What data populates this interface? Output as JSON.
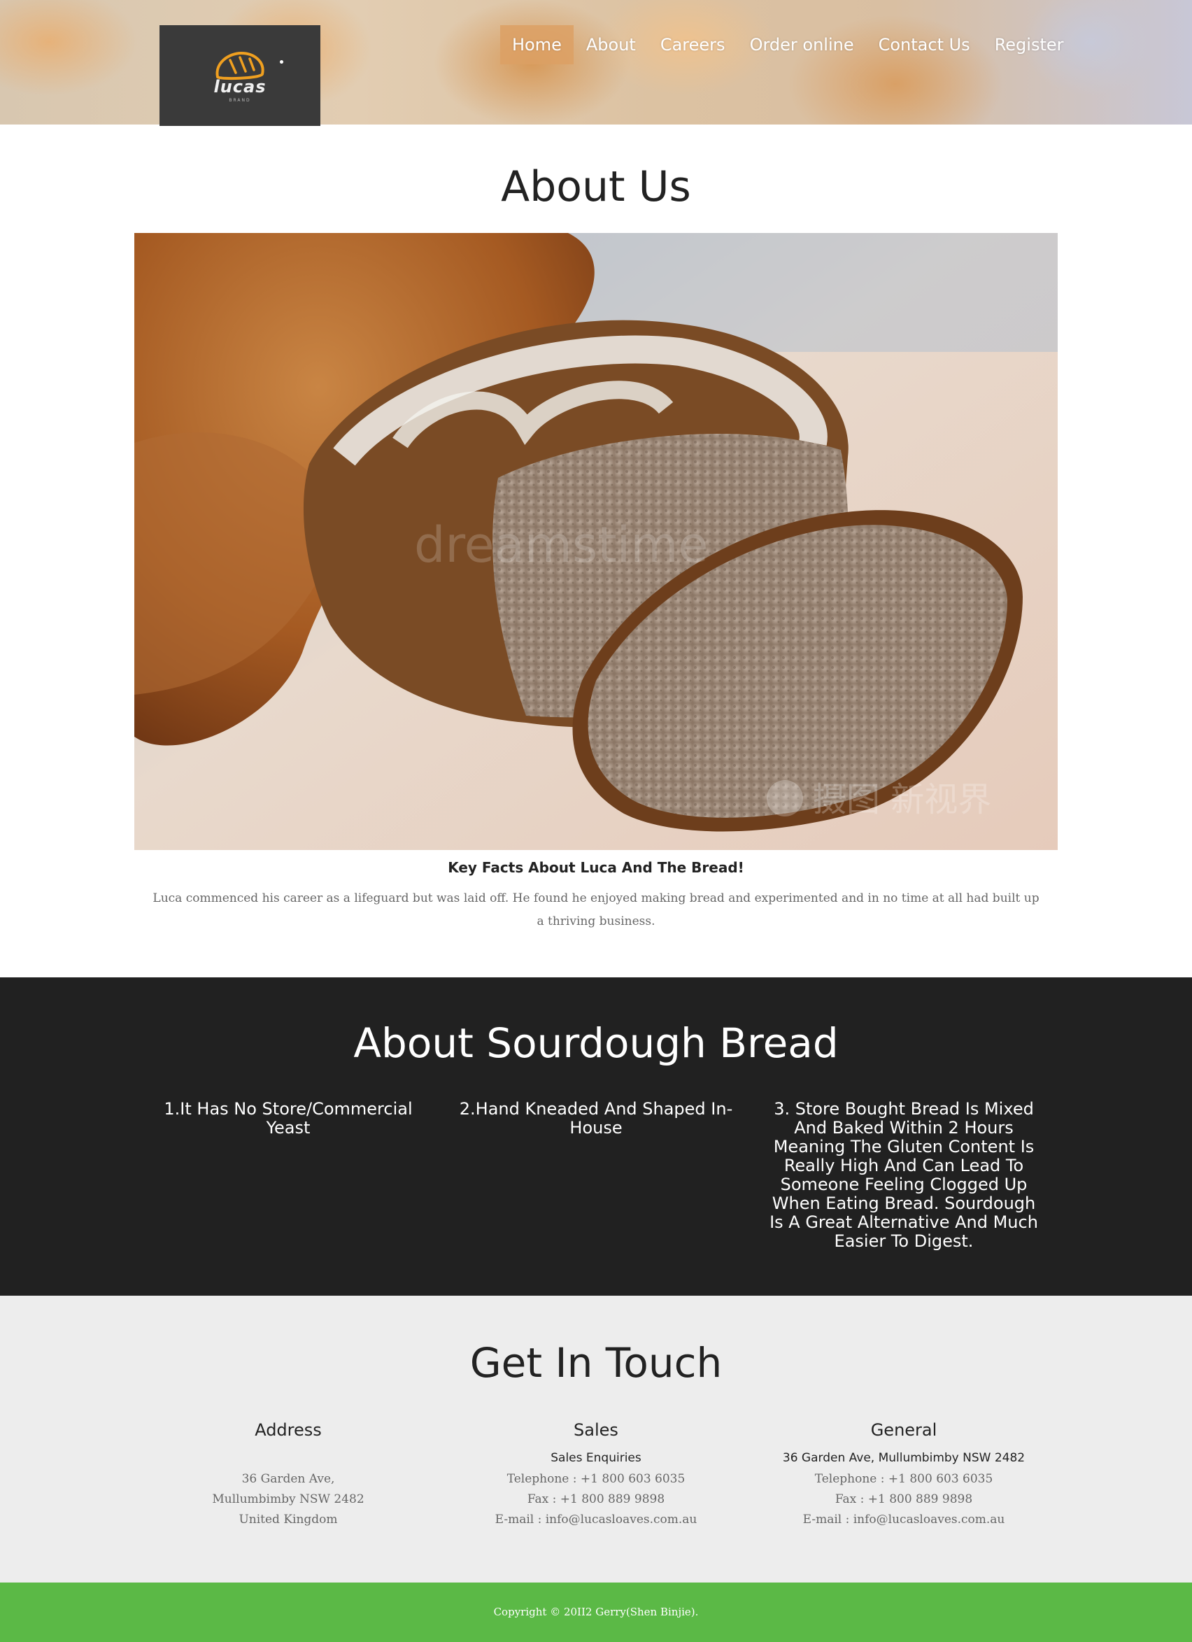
{
  "header": {
    "logo": {
      "text": "lucas",
      "subtext": "BRAND"
    },
    "nav": [
      {
        "label": "Home",
        "active": true
      },
      {
        "label": "About",
        "active": false
      },
      {
        "label": "Careers",
        "active": false
      },
      {
        "label": "Order online",
        "active": false
      },
      {
        "label": "Contact Us",
        "active": false
      },
      {
        "label": "Register",
        "active": false
      }
    ]
  },
  "about": {
    "title": "About Us",
    "image_alt": "bread-loaf-photo",
    "facts_title": "Key Facts About Luca And The Bread!",
    "facts_text": "Luca commenced his career as a lifeguard but was laid off. He found he enjoyed making bread and experimented and in no time at all had built up a thriving business."
  },
  "sourdough": {
    "title": "About Sourdough Bread",
    "points": [
      "1.It Has No Store/Commercial Yeast",
      "2.Hand Kneaded And Shaped In-House",
      "3. Store Bought Bread Is Mixed And Baked Within 2 Hours Meaning The Gluten Content Is Really High And Can Lead To Someone Feeling Clogged Up When Eating Bread. Sourdough Is A Great Alternative And Much Easier To Digest."
    ]
  },
  "touch": {
    "title": "Get In Touch",
    "address": {
      "heading": "Address",
      "lines": [
        "36 Garden Ave,",
        "Mullumbimby NSW 2482",
        "United Kingdom"
      ]
    },
    "sales": {
      "heading": "Sales",
      "subheading": "Sales Enquiries",
      "lines": [
        "Telephone : +1 800 603 6035",
        "Fax : +1 800 889 9898",
        "E-mail : info@lucasloaves.com.au"
      ]
    },
    "general": {
      "heading": "General",
      "subheading": "36 Garden Ave, Mullumbimby NSW 2482",
      "lines": [
        "Telephone : +1 800 603 6035",
        "Fax : +1 800 889 9898",
        "E-mail : info@lucasloaves.com.au"
      ]
    }
  },
  "footer": {
    "copyright": "Copyright © 20II2 Gerry(Shen Binjie)."
  },
  "colors": {
    "dark_section": "#212121",
    "light_section": "#ededed",
    "footer_green": "#5bb946",
    "nav_active": "#dca064",
    "logo_orange": "#f0a020"
  }
}
